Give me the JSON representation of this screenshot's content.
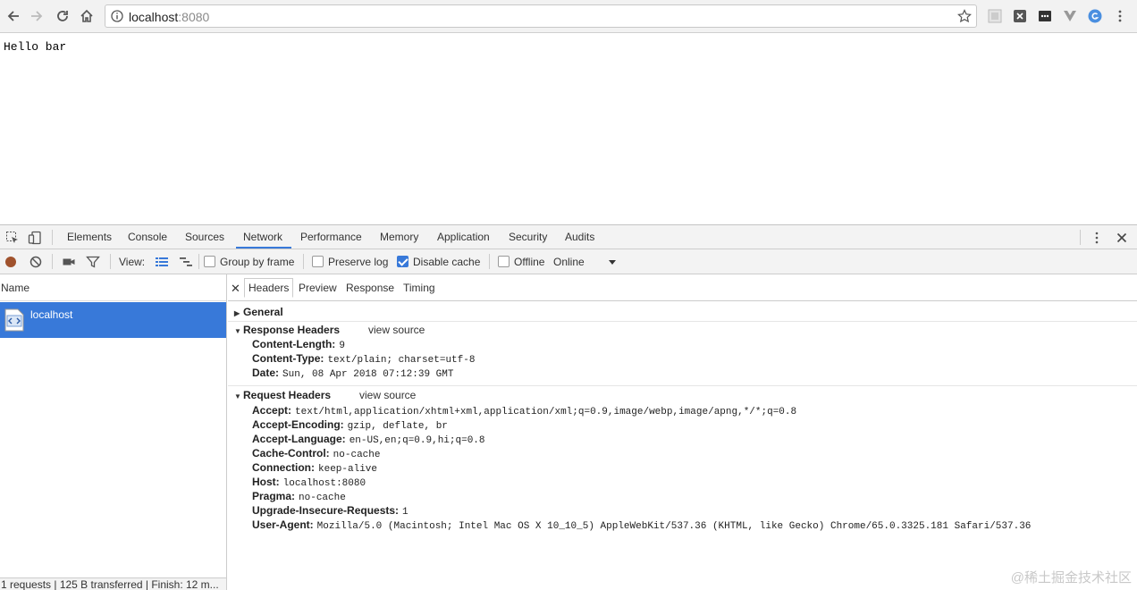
{
  "browser": {
    "url_host": "localhost",
    "url_port": ":8080"
  },
  "page": {
    "body_text": "Hello bar"
  },
  "devtools": {
    "tabs": [
      "Elements",
      "Console",
      "Sources",
      "Network",
      "Performance",
      "Memory",
      "Application",
      "Security",
      "Audits"
    ],
    "active_tab": "Network",
    "toolbar": {
      "view_label": "View:",
      "group_by_frame": "Group by frame",
      "preserve_log": "Preserve log",
      "disable_cache": "Disable cache",
      "disable_cache_checked": true,
      "offline": "Offline",
      "throttle": "Online"
    },
    "list": {
      "column_name": "Name",
      "requests": [
        {
          "name": "localhost"
        }
      ],
      "status": "1 requests | 125 B transferred | Finish: 12 m..."
    },
    "detail": {
      "tabs": [
        "Headers",
        "Preview",
        "Response",
        "Timing"
      ],
      "active": "Headers",
      "general_title": "General",
      "response_title": "Response Headers",
      "request_title": "Request Headers",
      "view_source": "view source",
      "response_headers": [
        {
          "k": "Content-Length:",
          "v": "9"
        },
        {
          "k": "Content-Type:",
          "v": "text/plain; charset=utf-8"
        },
        {
          "k": "Date:",
          "v": "Sun, 08 Apr 2018 07:12:39 GMT"
        }
      ],
      "request_headers": [
        {
          "k": "Accept:",
          "v": "text/html,application/xhtml+xml,application/xml;q=0.9,image/webp,image/apng,*/*;q=0.8"
        },
        {
          "k": "Accept-Encoding:",
          "v": "gzip, deflate, br"
        },
        {
          "k": "Accept-Language:",
          "v": "en-US,en;q=0.9,hi;q=0.8"
        },
        {
          "k": "Cache-Control:",
          "v": "no-cache"
        },
        {
          "k": "Connection:",
          "v": "keep-alive"
        },
        {
          "k": "Host:",
          "v": "localhost:8080"
        },
        {
          "k": "Pragma:",
          "v": "no-cache"
        },
        {
          "k": "Upgrade-Insecure-Requests:",
          "v": "1"
        },
        {
          "k": "User-Agent:",
          "v": "Mozilla/5.0 (Macintosh; Intel Mac OS X 10_10_5) AppleWebKit/537.36 (KHTML, like Gecko) Chrome/65.0.3325.181 Safari/537.36"
        }
      ]
    }
  },
  "watermark": "@稀土掘金技术社区",
  "colors": {
    "accent": "#3879d9",
    "record": "#a0522d"
  }
}
